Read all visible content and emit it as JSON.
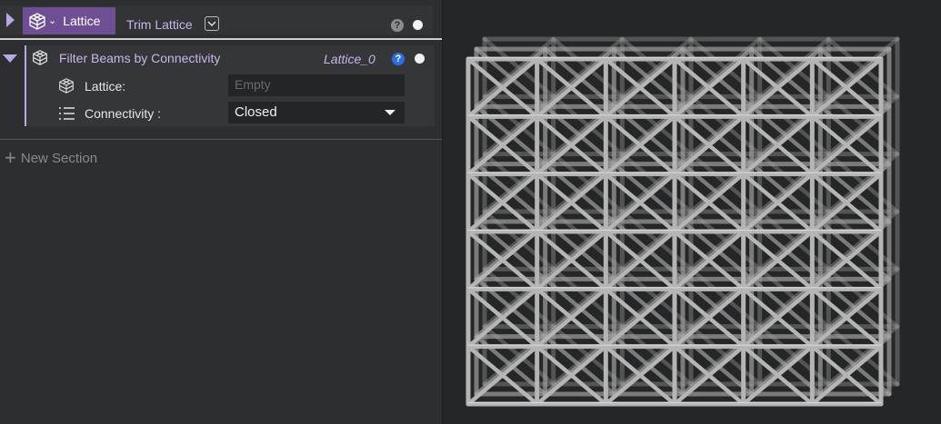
{
  "top_row": {
    "tag_label": "Lattice",
    "trim_name": "Trim Lattice",
    "help_glyph": "?"
  },
  "section": {
    "title": "Filter Beams by Connectivity",
    "output_name": "Lattice_0",
    "help_glyph": "?",
    "props": {
      "lattice_label": "Lattice:",
      "lattice_placeholder": "Empty",
      "connectivity_label": "Connectivity :",
      "connectivity_value": "Closed"
    }
  },
  "new_section_label": "New Section",
  "icons": {
    "expand": "triangle-right-icon",
    "collapse": "triangle-down-icon",
    "lattice": "lattice-cube-icon",
    "list": "list-icon",
    "help": "help-icon"
  },
  "colors": {
    "accent_purple": "#6f4f94",
    "accent_lavender": "#b9a7e6",
    "help_blue": "#2e6fe0",
    "panel_bg": "#2d2e2f",
    "viewport_bg": "#252627",
    "lattice_metal": "#b5b5b5"
  }
}
